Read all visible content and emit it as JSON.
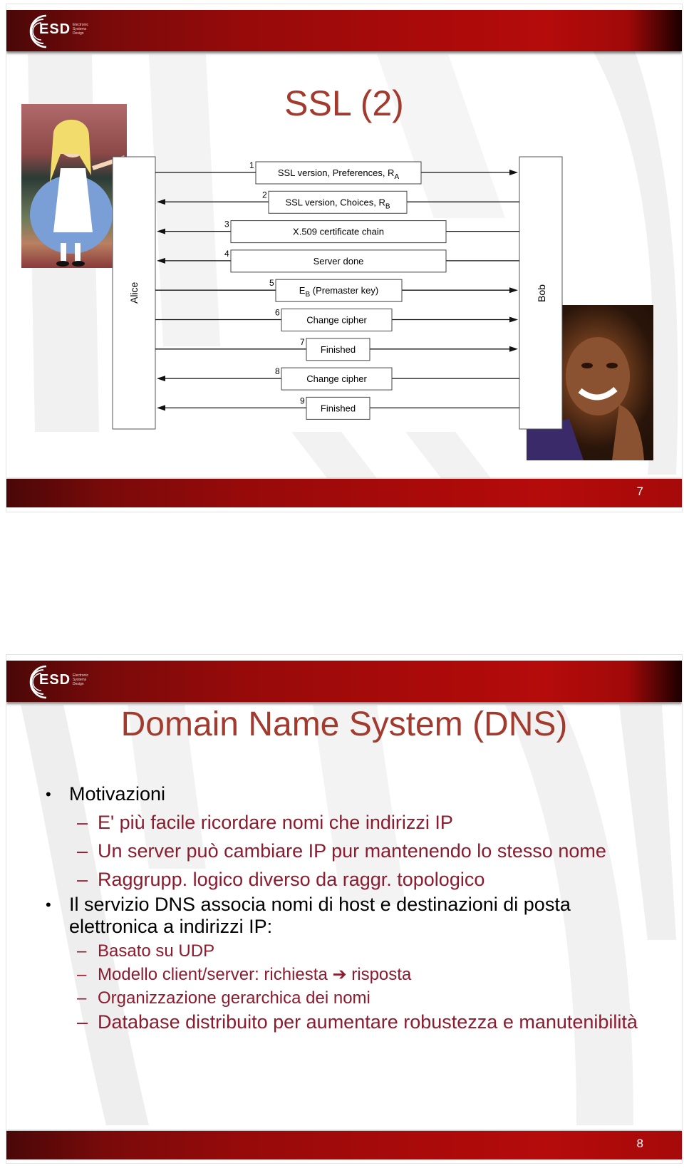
{
  "colors": {
    "brand_red": "#a90a0a",
    "title_color": "#a33a2e",
    "subbullet_color": "#8c1b2e",
    "bullet_color": "#000000"
  },
  "logo": {
    "name": "ESD",
    "subtitle_lines": [
      "Electronic",
      "Systems",
      "Design"
    ]
  },
  "slides": [
    {
      "title": "SSL (2)",
      "page_number": "7",
      "diagram": {
        "left_party": "Alice",
        "right_party": "Bob",
        "images": [
          "alice-picture",
          "bob-picture"
        ],
        "messages": [
          {
            "num": "1",
            "text": "SSL version, Preferences, R",
            "sub": "A",
            "direction": "to-bob"
          },
          {
            "num": "2",
            "text": "SSL version, Choices, R",
            "sub": "B",
            "direction": "to-alice"
          },
          {
            "num": "3",
            "text": "X.509 certificate chain",
            "sub": "",
            "direction": "to-alice"
          },
          {
            "num": "4",
            "text": "Server done",
            "sub": "",
            "direction": "to-alice"
          },
          {
            "num": "5",
            "text": "E",
            "sub": "B",
            "suffix": " (Premaster key)",
            "direction": "to-bob"
          },
          {
            "num": "6",
            "text": "Change cipher",
            "sub": "",
            "direction": "to-bob"
          },
          {
            "num": "7",
            "text": "Finished",
            "sub": "",
            "direction": "to-bob"
          },
          {
            "num": "8",
            "text": "Change cipher",
            "sub": "",
            "direction": "to-alice"
          },
          {
            "num": "9",
            "text": "Finished",
            "sub": "",
            "direction": "to-alice"
          }
        ]
      }
    },
    {
      "title": "Domain Name System (DNS)",
      "page_number": "8",
      "bullets": [
        {
          "text": "Motivazioni",
          "subitems": [
            "E' più facile ricordare nomi che indirizzi IP",
            "Un server può cambiare IP pur mantenendo lo stesso nome",
            "Raggrupp. logico diverso da raggr. topologico"
          ]
        },
        {
          "text": "Il servizio DNS associa nomi di host e destinazioni di posta elettronica a indirizzi IP:",
          "subitems": [
            "Basato su UDP",
            "Modello client/server: richiesta ➔  risposta",
            "Organizzazione gerarchica dei nomi",
            "Database distribuito per aumentare robustezza e manutenibilità"
          ]
        }
      ]
    }
  ]
}
